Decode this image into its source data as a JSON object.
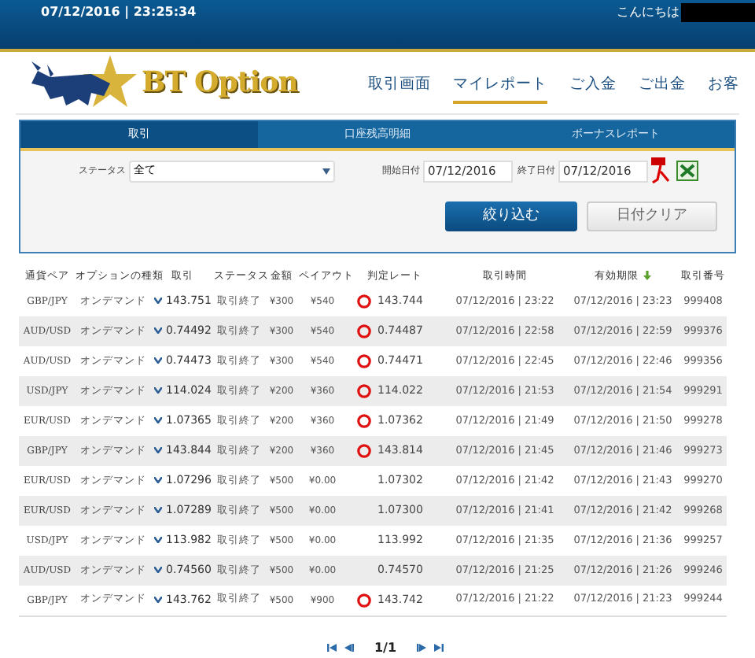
{
  "header": {
    "datetime": "07/12/2016 | 23:25:34",
    "greeting": "こんにちは"
  },
  "logo": {
    "text": "BT Option"
  },
  "nav": [
    {
      "label": "取引画面",
      "selected": false
    },
    {
      "label": "マイレポート",
      "selected": true
    },
    {
      "label": "ご入金",
      "selected": false
    },
    {
      "label": "ご出金",
      "selected": false
    },
    {
      "label": "お客",
      "selected": false
    }
  ],
  "tabs": [
    {
      "label": "取引",
      "selected": true
    },
    {
      "label": "口座残高明細",
      "selected": false
    },
    {
      "label": "ボーナスレポート",
      "selected": false
    }
  ],
  "filter": {
    "status_label": "ステータス",
    "status_value": "全て",
    "start_label": "開始日付",
    "start_value": "07/12/2016",
    "end_label": "終了日付",
    "end_value": "07/12/2016",
    "apply_button": "絞り込む",
    "clear_button": "日付クリア"
  },
  "table": {
    "columns": [
      "通貨ペア",
      "オプションの種類",
      "取引",
      "ステータス",
      "金額",
      "ペイアウト",
      "判定レート",
      "取引時間",
      "有効期限",
      "取引番号"
    ],
    "rows": [
      {
        "pair": "GBP/JPY",
        "type": "オンデマンド",
        "rate": "143.751",
        "down": true,
        "status": "取引終了",
        "amount": "¥300",
        "payout": "¥540",
        "won": true,
        "judgment": "143.744",
        "time": "07/12/2016 | 23:22",
        "expiry": "07/12/2016 | 23:23",
        "id": "999408"
      },
      {
        "pair": "AUD/USD",
        "type": "オンデマンド",
        "rate": "0.74492",
        "down": true,
        "status": "取引終了",
        "amount": "¥300",
        "payout": "¥540",
        "won": true,
        "judgment": "0.74487",
        "time": "07/12/2016 | 22:58",
        "expiry": "07/12/2016 | 22:59",
        "id": "999376"
      },
      {
        "pair": "AUD/USD",
        "type": "オンデマンド",
        "rate": "0.74473",
        "down": true,
        "status": "取引終了",
        "amount": "¥300",
        "payout": "¥540",
        "won": true,
        "judgment": "0.74471",
        "time": "07/12/2016 | 22:45",
        "expiry": "07/12/2016 | 22:46",
        "id": "999356"
      },
      {
        "pair": "USD/JPY",
        "type": "オンデマンド",
        "rate": "114.024",
        "down": true,
        "status": "取引終了",
        "amount": "¥200",
        "payout": "¥360",
        "won": true,
        "judgment": "114.022",
        "time": "07/12/2016 | 21:53",
        "expiry": "07/12/2016 | 21:54",
        "id": "999291"
      },
      {
        "pair": "EUR/USD",
        "type": "オンデマンド",
        "rate": "1.07365",
        "down": true,
        "status": "取引終了",
        "amount": "¥200",
        "payout": "¥360",
        "won": true,
        "judgment": "1.07362",
        "time": "07/12/2016 | 21:49",
        "expiry": "07/12/2016 | 21:50",
        "id": "999278"
      },
      {
        "pair": "GBP/JPY",
        "type": "オンデマンド",
        "rate": "143.844",
        "down": true,
        "status": "取引終了",
        "amount": "¥200",
        "payout": "¥360",
        "won": true,
        "judgment": "143.814",
        "time": "07/12/2016 | 21:45",
        "expiry": "07/12/2016 | 21:46",
        "id": "999273"
      },
      {
        "pair": "EUR/USD",
        "type": "オンデマンド",
        "rate": "1.07296",
        "down": true,
        "status": "取引終了",
        "amount": "¥500",
        "payout": "¥0.00",
        "won": false,
        "judgment": "1.07302",
        "time": "07/12/2016 | 21:42",
        "expiry": "07/12/2016 | 21:43",
        "id": "999270"
      },
      {
        "pair": "EUR/USD",
        "type": "オンデマンド",
        "rate": "1.07289",
        "down": true,
        "status": "取引終了",
        "amount": "¥500",
        "payout": "¥0.00",
        "won": false,
        "judgment": "1.07300",
        "time": "07/12/2016 | 21:41",
        "expiry": "07/12/2016 | 21:42",
        "id": "999268"
      },
      {
        "pair": "USD/JPY",
        "type": "オンデマンド",
        "rate": "113.982",
        "down": true,
        "status": "取引終了",
        "amount": "¥500",
        "payout": "¥0.00",
        "won": false,
        "judgment": "113.992",
        "time": "07/12/2016 | 21:35",
        "expiry": "07/12/2016 | 21:36",
        "id": "999257"
      },
      {
        "pair": "AUD/USD",
        "type": "オンデマンド",
        "rate": "0.74560",
        "down": true,
        "status": "取引終了",
        "amount": "¥500",
        "payout": "¥0.00",
        "won": false,
        "judgment": "0.74570",
        "time": "07/12/2016 | 21:25",
        "expiry": "07/12/2016 | 21:26",
        "id": "999246"
      },
      {
        "pair": "GBP/JPY",
        "type": "オンデマンド",
        "rate": "143.762",
        "down": true,
        "status": "取引終了",
        "amount": "¥500",
        "payout": "¥900",
        "won": true,
        "judgment": "143.742",
        "time": "07/12/2016 | 21:22",
        "expiry": "07/12/2016 | 21:23",
        "id": "999244"
      }
    ]
  },
  "pagination": {
    "page": "1/1"
  }
}
